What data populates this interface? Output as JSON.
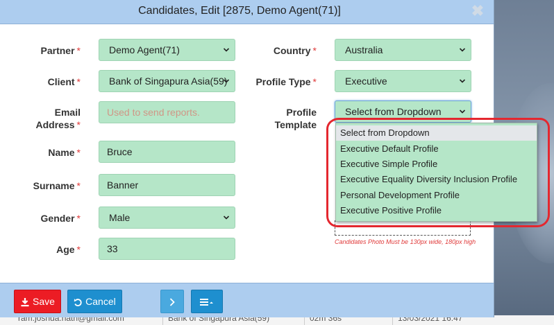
{
  "modal": {
    "title": "Candidates, Edit [2875, Demo Agent(71)]",
    "close_glyph": "✖"
  },
  "form": {
    "partner": {
      "label": "Partner",
      "value": "Demo Agent(71)"
    },
    "client": {
      "label": "Client",
      "value": "Bank of Singapura Asia(59)"
    },
    "email": {
      "label_line1": "Email",
      "label_line2": "Address",
      "placeholder": "Used to send reports."
    },
    "name": {
      "label": "Name",
      "value": "Bruce"
    },
    "surname": {
      "label": "Surname",
      "value": "Banner"
    },
    "gender": {
      "label": "Gender",
      "value": "Male"
    },
    "age": {
      "label": "Age",
      "value": "33"
    },
    "country": {
      "label": "Country",
      "value": "Australia"
    },
    "profile_type": {
      "label": "Profile Type",
      "value": "Executive"
    },
    "profile_template": {
      "label_line1": "Profile",
      "label_line2": "Template",
      "value": "Select from Dropdown"
    },
    "required_mark": "*"
  },
  "dropdown_options": [
    "Select from Dropdown",
    "Executive Default Profile",
    "Executive Simple Profile",
    "Executive Equality Diversity Inclusion Profile",
    "Personal Development Profile",
    "Executive Positive Profile"
  ],
  "photo_note": "Candidates Photo Must be 130px wide, 180px high",
  "footer": {
    "save_label": "Save",
    "cancel_label": "Cancel"
  },
  "background_row": {
    "email": "ram.joshua.nath@gmail.com",
    "client": "Bank of Singapura Asia(59)",
    "duration": "02m 36s",
    "date": "13/03/2021 16:47"
  },
  "colors": {
    "header": "#adcdef",
    "field": "#b5e6c8",
    "save": "#ec1c24",
    "primary": "#1e8fcf",
    "required": "#e03a3a",
    "annotation": "#e4272f"
  },
  "icons": [
    "close-icon",
    "chevron-down-icon",
    "download-icon",
    "undo-icon",
    "chevron-right-icon",
    "menu-icon",
    "resize-icon"
  ]
}
